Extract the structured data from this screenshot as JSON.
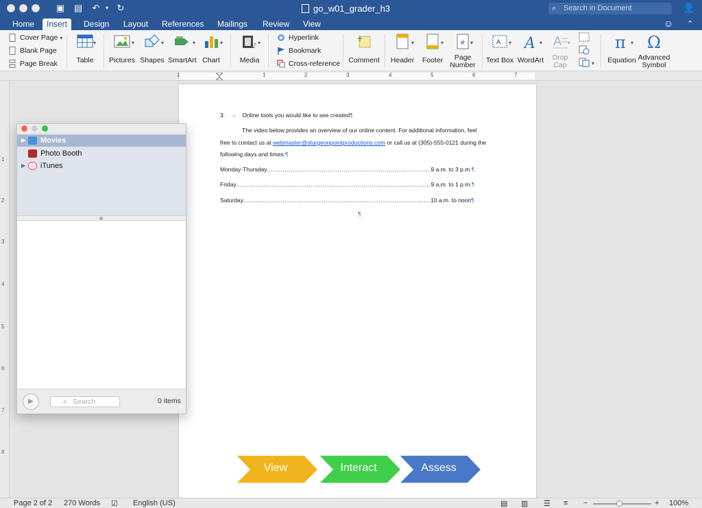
{
  "window": {
    "title": "go_w01_grader_h3",
    "search_placeholder": "Search in Document"
  },
  "tabs": [
    "Home",
    "Insert",
    "Design",
    "Layout",
    "References",
    "Mailings",
    "Review",
    "View"
  ],
  "ribbon": {
    "pages": [
      "Cover Page",
      "Blank Page",
      "Page Break"
    ],
    "table": "Table",
    "pictures": "Pictures",
    "shapes": "Shapes",
    "smartart": "SmartArt",
    "chart": "Chart",
    "media": "Media",
    "links": [
      "Hyperlink",
      "Bookmark",
      "Cross-reference"
    ],
    "comment": "Comment",
    "header": "Header",
    "footer": "Footer",
    "page_number": "Page Number",
    "text_box": "Text Box",
    "wordart": "WordArt",
    "drop_cap": "Drop Cap",
    "equation": "Equation",
    "advanced_symbol": "Advanced Symbol"
  },
  "ruler": [
    "1",
    "1",
    "2",
    "3",
    "4",
    "5",
    "6",
    "7"
  ],
  "vruler": [
    "1",
    "2",
    "3",
    "4",
    "5",
    "6",
    "7",
    "8"
  ],
  "document": {
    "item_number": "3.",
    "heading": "Online tools you would like to see created",
    "body_line1": "The video below provides an overview of our online content. For additional information, feel",
    "body_line2_pre": "free to contact us at ",
    "email": "webmaster@sturgeonpointproductions.com",
    "body_line2_post": " or call us at (305)-555-0121 during the",
    "body_line3": "following days and times:",
    "schedule": [
      {
        "day": "Monday-Thursday",
        "hours": "9 a.m. to 3 p.m."
      },
      {
        "day": "Friday",
        "hours": "9 a.m. to 1 p.m."
      },
      {
        "day": "Saturday",
        "hours": "10 a.m. to noon"
      }
    ],
    "chevrons": [
      {
        "label": "View",
        "color": "#f2b41c"
      },
      {
        "label": "Interact",
        "color": "#3fcf4a"
      },
      {
        "label": "Assess",
        "color": "#4a78c8"
      }
    ]
  },
  "media_browser": {
    "sources": [
      "Movies",
      "Photo Booth",
      "iTunes"
    ],
    "search_placeholder": "Search",
    "item_count": "0 items"
  },
  "status": {
    "page": "Page 2 of 2",
    "words": "270 Words",
    "language": "English (US)",
    "zoom": "100%"
  }
}
